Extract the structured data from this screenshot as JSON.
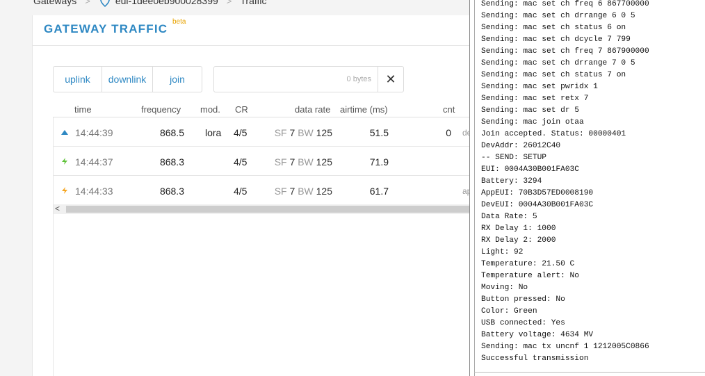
{
  "breadcrumb": {
    "items": [
      "Gateways",
      "eui-1dee0eb900028399",
      "Traffic"
    ]
  },
  "card": {
    "title": "GATEWAY TRAFFIC",
    "badge": "beta"
  },
  "filters": {
    "uplink": "uplink",
    "downlink": "downlink",
    "join": "join",
    "bytes": "0 bytes",
    "clear": "✕"
  },
  "table": {
    "headers": [
      "time",
      "frequency",
      "mod.",
      "CR",
      "data rate",
      "airtime (ms)",
      "cnt"
    ],
    "rows": [
      {
        "icon": "uplink-triangle-icon",
        "time": "14:44:39",
        "frequency": "868.5",
        "mod": "lora",
        "cr": "4/5",
        "sf_label": "SF",
        "sf": "7",
        "bw_label": "BW",
        "bw": "125",
        "airtime": "51.5",
        "cnt": "0",
        "extra": "de"
      },
      {
        "icon": "join-bolt-icon",
        "time": "14:44:37",
        "frequency": "868.3",
        "mod": "",
        "cr": "4/5",
        "sf_label": "SF",
        "sf": "7",
        "bw_label": "BW",
        "bw": "125",
        "airtime": "71.9",
        "cnt": "",
        "extra": ""
      },
      {
        "icon": "join-accept-bolt-icon",
        "time": "14:44:33",
        "frequency": "868.3",
        "mod": "",
        "cr": "4/5",
        "sf_label": "SF",
        "sf": "7",
        "bw_label": "BW",
        "bw": "125",
        "airtime": "61.7",
        "cnt": "",
        "extra": "ap"
      }
    ],
    "scroll_arrow": "<"
  },
  "console": {
    "lines": [
      "Sending: mac set ch freq 6 867700000",
      "Sending: mac set ch drrange 6 0 5",
      "Sending: mac set ch status 6 on",
      "Sending: mac set ch dcycle 7 799",
      "Sending: mac set ch freq 7 867900000",
      "Sending: mac set ch drrange 7 0 5",
      "Sending: mac set ch status 7 on",
      "Sending: mac set pwridx 1",
      "Sending: mac set retx 7",
      "Sending: mac set dr 5",
      "Sending: mac join otaa",
      "Join accepted. Status: 00000401",
      "DevAddr: 26012C40",
      "-- SEND: SETUP",
      "EUI: 0004A30B001FA03C",
      "Battery: 3294",
      "AppEUI: 70B3D57ED0008190",
      "DevEUI: 0004A30B001FA03C",
      "Data Rate: 5",
      "RX Delay 1: 1000",
      "RX Delay 2: 2000",
      "Light: 92",
      "Temperature: 21.50 C",
      "Temperature alert: No",
      "Moving: No",
      "Button pressed: No",
      "Color: Green",
      "USB connected: Yes",
      "Battery voltage: 4634 MV",
      "Sending: mac tx uncnf 1 1212005C0866",
      "Successful transmission"
    ]
  },
  "colors": {
    "accent": "#2e88c3",
    "beta": "#e8a300",
    "uplink_icon": "#2e88c3",
    "join_request_icon": "#5fc23a",
    "join_accept_icon": "#f5a623"
  }
}
